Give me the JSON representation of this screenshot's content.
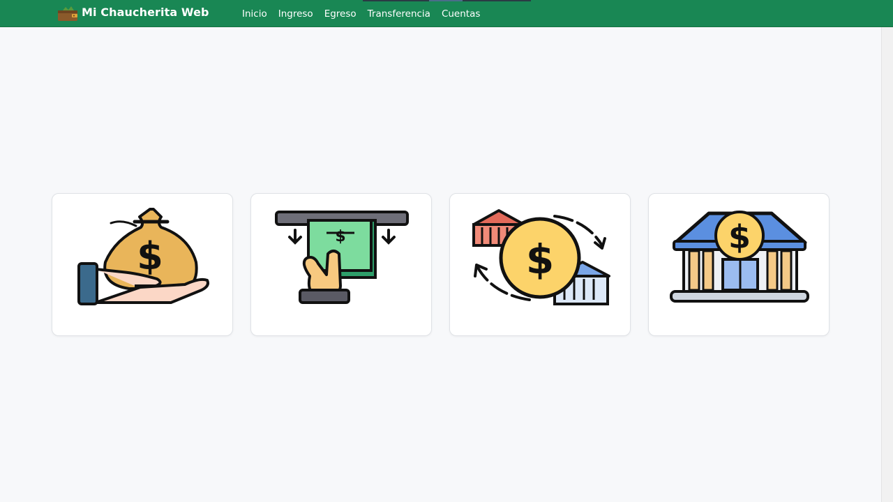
{
  "brand": {
    "name": "Mi Chaucherita Web",
    "logo_icon": "wallet-icon"
  },
  "nav": {
    "links": [
      {
        "label": "Inicio"
      },
      {
        "label": "Ingreso"
      },
      {
        "label": "Egreso"
      },
      {
        "label": "Transferencia"
      },
      {
        "label": "Cuentas"
      }
    ]
  },
  "cards": [
    {
      "icon": "money-bag-in-hand-icon",
      "meaning": "ingreso"
    },
    {
      "icon": "atm-cash-withdrawal-icon",
      "meaning": "egreso"
    },
    {
      "icon": "bank-transfer-icon",
      "meaning": "transferencia"
    },
    {
      "icon": "bank-building-icon",
      "meaning": "cuentas"
    }
  ],
  "colors": {
    "navbar": "#198754",
    "background": "#f7f8fa",
    "card": "#ffffff"
  }
}
